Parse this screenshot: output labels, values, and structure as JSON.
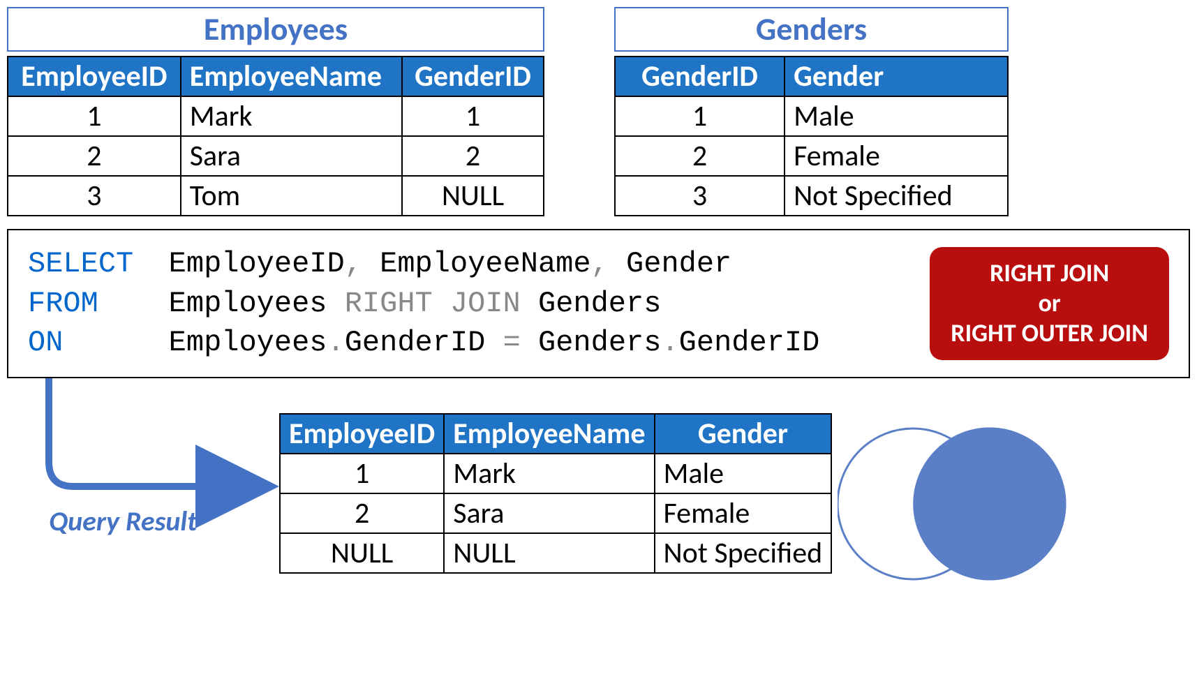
{
  "tables": {
    "employees": {
      "title": "Employees",
      "headers": [
        "EmployeeID",
        "EmployeeName",
        "GenderID"
      ],
      "rows": [
        {
          "id": "1",
          "name": "Mark",
          "gid": "1"
        },
        {
          "id": "2",
          "name": "Sara",
          "gid": "2"
        },
        {
          "id": "3",
          "name": "Tom",
          "gid": "NULL"
        }
      ]
    },
    "genders": {
      "title": "Genders",
      "headers": [
        "GenderID",
        "Gender"
      ],
      "rows": [
        {
          "id": "1",
          "g": "Male"
        },
        {
          "id": "2",
          "g": "Female"
        },
        {
          "id": "3",
          "g": "Not Specified"
        }
      ]
    },
    "result": {
      "headers": [
        "EmployeeID",
        "EmployeeName",
        "Gender"
      ],
      "rows": [
        {
          "id": "1",
          "name": "Mark",
          "g": "Male"
        },
        {
          "id": "2",
          "name": "Sara",
          "g": "Female"
        },
        {
          "id": "NULL",
          "name": "NULL",
          "g": "Not Specified"
        }
      ]
    }
  },
  "sql": {
    "select_kw": "SELECT",
    "select_cols": "EmployeeID",
    "select_col2": "EmployeeName",
    "select_col3": "Gender",
    "from_kw": "FROM",
    "from_tbl": "Employees",
    "join_kw": "RIGHT JOIN",
    "join_tbl": "Genders",
    "on_kw": "ON",
    "on_expr_l": "Employees",
    "on_expr_lc": "GenderID",
    "on_eq": "=",
    "on_expr_r": "Genders",
    "on_expr_rc": "GenderID",
    "comma": ",",
    "dot": "."
  },
  "badge": {
    "line1": "RIGHT JOIN",
    "line2": "or",
    "line3": "RIGHT OUTER JOIN"
  },
  "labels": {
    "query_result": "Query Result"
  },
  "colors": {
    "brand": "#4472c4",
    "headerbg": "#1f74c6",
    "badge": "#b90e0e"
  }
}
